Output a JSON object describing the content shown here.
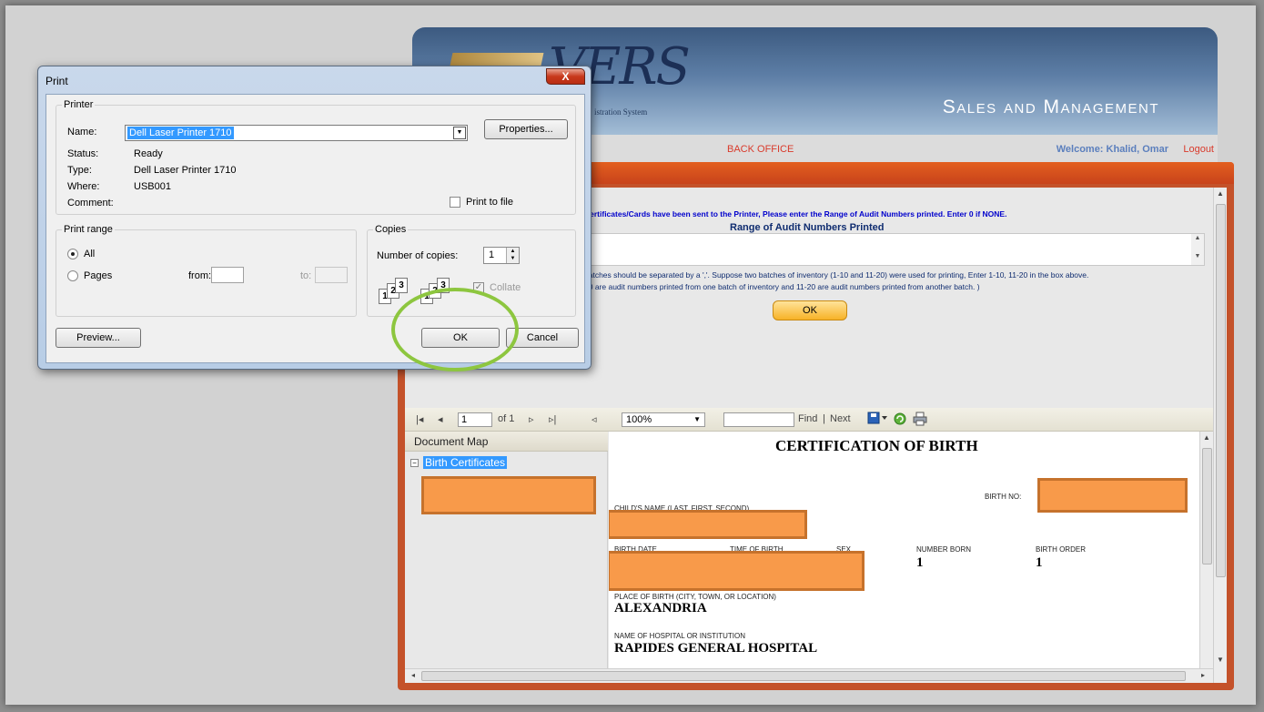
{
  "app": {
    "logo_text": "VERS",
    "logo_sub": "istration System",
    "title": "Sales and Management",
    "nav_back_office": "BACK OFFICE",
    "welcome": "Welcome: Khalid, Omar",
    "logout": "Logout"
  },
  "panel": {
    "message": "Certificates/Cards have been sent to the Printer, Please enter the Range of Audit Numbers printed. Enter 0 if NONE.",
    "range_label": "Range of Audit Numbers Printed",
    "range_value": "",
    "hint_line1": "batches should be separated by a ','. Suppose two batches of inventory (1-10 and 11-20) were used for printing, Enter 1-10, 11-20 in the box above.",
    "hint_line2": "10 are audit numbers printed from one batch of inventory and 11-20 are audit numbers printed from another batch. )",
    "ok_label": "OK"
  },
  "viewer": {
    "page_number": "1",
    "page_of": "of 1",
    "zoom": "100%",
    "find_value": "",
    "find_label": "Find",
    "separator": "|",
    "next_label": "Next",
    "document_map_label": "Document Map",
    "document_map_node": "Birth Certificates"
  },
  "report": {
    "title": "CERTIFICATION OF BIRTH",
    "birth_no_label": "BIRTH NO:",
    "childs_name_label": "CHILD'S NAME (LAST, FIRST, SECOND)",
    "birth_date_label": "BIRTH DATE",
    "time_of_birth_label": "TIME OF BIRTH",
    "sex_label": "SEX",
    "number_born_label": "NUMBER BORN",
    "number_born_value": "1",
    "birth_order_label": "BIRTH ORDER",
    "birth_order_value": "1",
    "place_of_birth_label": "PLACE OF BIRTH (CITY, TOWN, OR LOCATION)",
    "place_of_birth_value": "ALEXANDRIA",
    "hospital_label": "NAME OF HOSPITAL OR INSTITUTION",
    "hospital_value": "RAPIDES GENERAL HOSPITAL"
  },
  "print_dialog": {
    "title": "Print",
    "close_label": "X",
    "printer_group": "Printer",
    "name_label": "Name:",
    "printer_name": "Dell Laser Printer 1710",
    "properties_label": "Properties...",
    "status_label": "Status:",
    "status_value": "Ready",
    "type_label": "Type:",
    "type_value": "Dell Laser Printer 1710",
    "where_label": "Where:",
    "where_value": "USB001",
    "comment_label": "Comment:",
    "comment_value": "",
    "print_to_file_label": "Print to file",
    "print_range_group": "Print range",
    "all_label": "All",
    "pages_label": "Pages",
    "from_label": "from:",
    "from_value": "",
    "to_label": "to:",
    "to_value": "",
    "copies_group": "Copies",
    "number_of_copies_label": "Number of copies:",
    "number_of_copies_value": "1",
    "collate_label": "Collate",
    "preview_label": "Preview...",
    "ok_label": "OK",
    "cancel_label": "Cancel"
  },
  "colors": {
    "accent_orange": "#c4522a",
    "highlight_green": "#8dc63f",
    "redaction": "#f89a4a",
    "link_red": "#d93a2b",
    "welcome_blue": "#5b7fbd"
  }
}
